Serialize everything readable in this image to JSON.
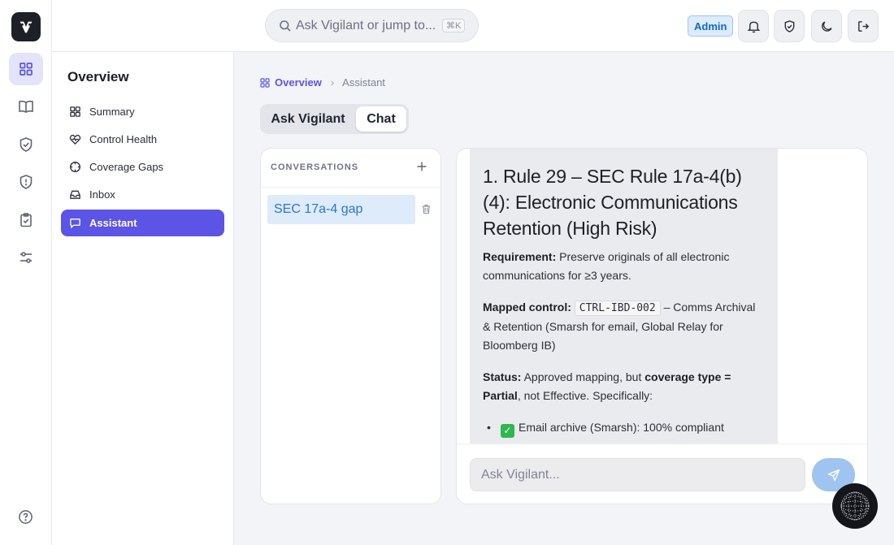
{
  "search": {
    "placeholder": "Ask Vigilant or jump to...",
    "shortcut": "⌘K"
  },
  "header": {
    "role_badge": "Admin"
  },
  "sidebar": {
    "title": "Overview",
    "items": [
      {
        "label": "Summary",
        "icon": "grid-icon"
      },
      {
        "label": "Control Health",
        "icon": "heart-pulse-icon"
      },
      {
        "label": "Coverage Gaps",
        "icon": "crosshair-icon"
      },
      {
        "label": "Inbox",
        "icon": "inbox-icon"
      },
      {
        "label": "Assistant",
        "icon": "chat-icon",
        "active": true
      }
    ]
  },
  "breadcrumb": {
    "home": "Overview",
    "current": "Assistant"
  },
  "tabs": [
    {
      "label": "Ask Vigilant",
      "active": false
    },
    {
      "label": "Chat",
      "active": true
    }
  ],
  "conversations": {
    "heading": "CONVERSATIONS",
    "items": [
      {
        "title": "SEC 17a-4 gap"
      }
    ]
  },
  "message": {
    "heading": "1. Rule 29 – SEC Rule 17a-4(b)(4): Electronic Communications Retention (High Risk)",
    "requirement_label": "Requirement:",
    "requirement_text": " Preserve originals of all electronic communications for ≥3 years.",
    "mapped_label": "Mapped control:",
    "mapped_code": "CTRL-IBD-002",
    "mapped_text": " – Comms Archival & Retention (Smarsh for email, Global Relay for Bloomberg IB)",
    "status_label": "Status:",
    "status_text_1": " Approved mapping, but ",
    "status_bold": "coverage type = Partial",
    "status_text_2": ", not Effective. Specifically:",
    "bullets": [
      "Email archive (Smarsh): 100% compliant"
    ]
  },
  "composer": {
    "placeholder": "Ask Vigilant..."
  },
  "colors": {
    "accent": "#5b54e6",
    "badge": "#1667c9",
    "selected_conversation": "#ddebfa",
    "send_button": "#9fc4ef",
    "success": "#2fb84f"
  }
}
